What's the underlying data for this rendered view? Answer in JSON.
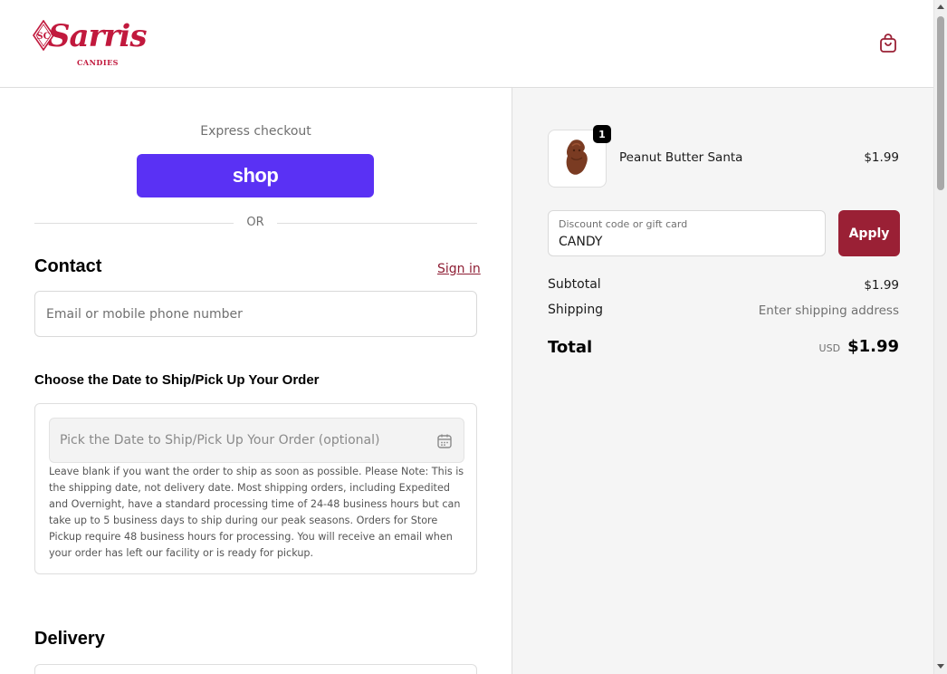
{
  "header": {
    "logo_script": "Sarris",
    "logo_sub": "CANDIES",
    "logo_mark": "SC",
    "cart_icon": "shopping-bag-icon"
  },
  "express": {
    "label": "Express checkout",
    "shop_label": "shop",
    "or_label": "OR"
  },
  "contact": {
    "title": "Contact",
    "signin_label": "Sign in",
    "email_placeholder": "Email or mobile phone number"
  },
  "ship_date": {
    "title": "Choose the Date to Ship/Pick Up Your Order",
    "placeholder": "Pick the Date to Ship/Pick Up Your Order (optional)",
    "calendar_icon": "calendar-icon",
    "help": "Leave blank if you want the order to ship as soon as possible. Please Note: This is the shipping date, not delivery date. Most shipping orders, including Expedited and Overnight, have a standard processing time of 24-48 business hours but can take up to 5 business days to ship during our peak seasons. Orders for Store Pickup require 48 business hours for processing. You will receive an email when your order has left our facility or is ready for pickup."
  },
  "delivery": {
    "title": "Delivery"
  },
  "summary": {
    "product": {
      "name": "Peanut Butter Santa",
      "price": "$1.99",
      "quantity": "1"
    },
    "discount": {
      "label": "Discount code or gift card",
      "value": "CANDY",
      "apply_label": "Apply"
    },
    "subtotal_label": "Subtotal",
    "subtotal_value": "$1.99",
    "shipping_label": "Shipping",
    "shipping_value": "Enter shipping address",
    "total_label": "Total",
    "total_currency": "USD",
    "total_value": "$1.99"
  },
  "colors": {
    "brand": "#c1193d",
    "apply": "#9a2035",
    "shop": "#5a31f4",
    "link": "#8e1e34"
  }
}
